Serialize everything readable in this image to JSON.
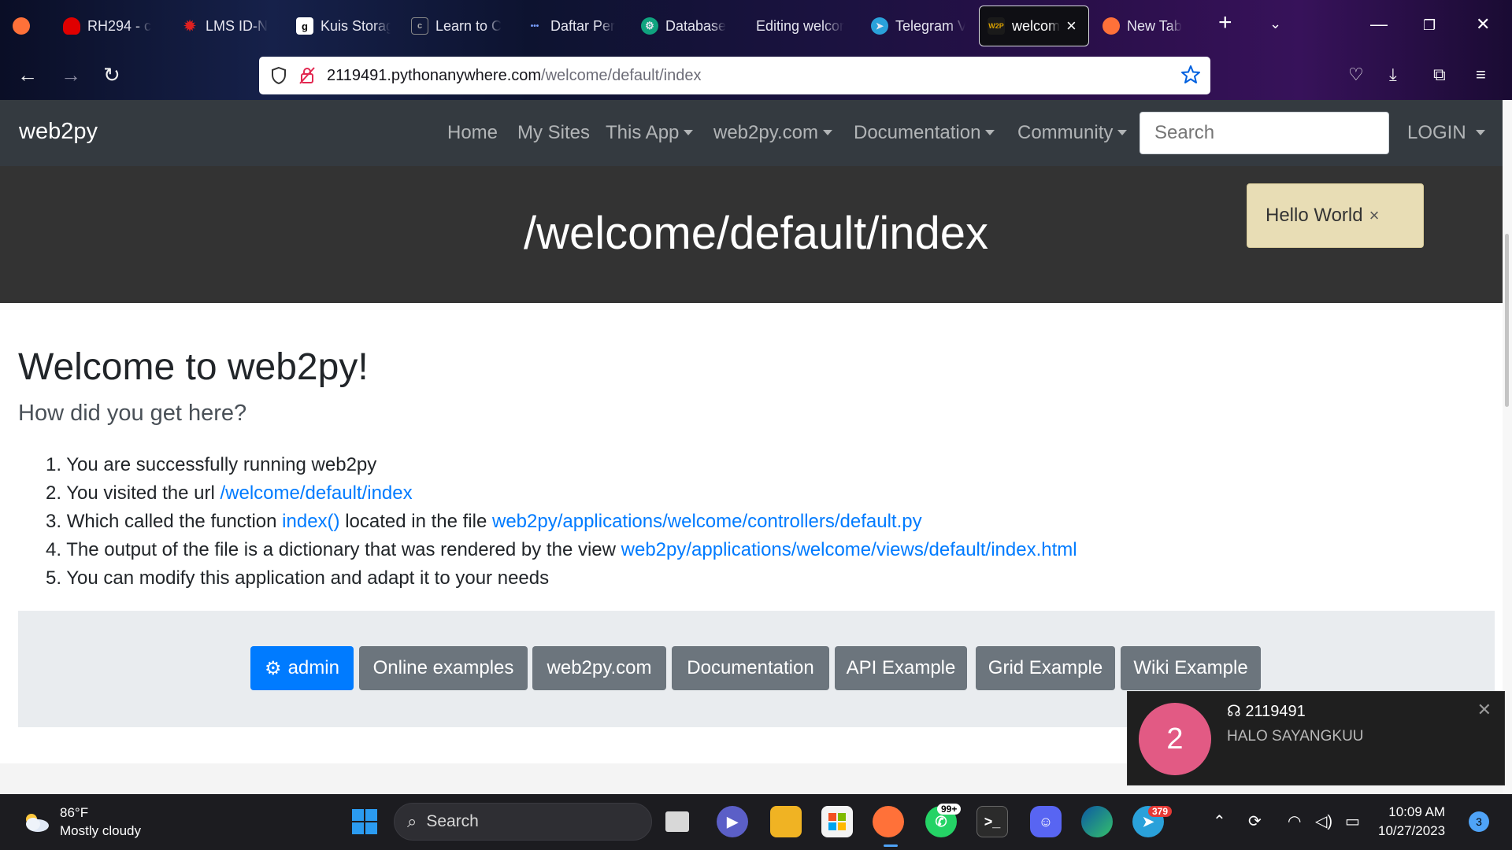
{
  "browser": {
    "tabs": [
      {
        "label": "RH294 - c",
        "icon": "redhat-icon",
        "color": "#e00000"
      },
      {
        "label": "LMS ID-N",
        "icon": "lms-icon",
        "color": "#e02020"
      },
      {
        "label": "Kuis Storag",
        "icon": "g-icon",
        "color": "#ffffff"
      },
      {
        "label": "Learn to C",
        "icon": "doc-icon",
        "color": "#888888"
      },
      {
        "label": "Daftar Per",
        "icon": "dots-icon",
        "color": "#3b6cff"
      },
      {
        "label": "Database",
        "icon": "chatgpt-icon",
        "color": "#10a37f"
      },
      {
        "label": "Editing welcor",
        "icon": "blank-icon",
        "color": "#444444"
      },
      {
        "label": "Telegram V",
        "icon": "telegram-icon",
        "color": "#2aa1da"
      },
      {
        "label": "welcom",
        "icon": "w2p-icon",
        "color": "#d9a000"
      },
      {
        "label": "New Tab",
        "icon": "firefox-icon",
        "color": "#ff7139"
      }
    ],
    "url_host": "2119491.pythonanywhere.com",
    "url_path": "/welcome/default/index"
  },
  "navbar": {
    "brand": "web2py",
    "items": [
      "Home",
      "My Sites",
      "This App",
      "web2py.com",
      "Documentation",
      "Community"
    ],
    "search_placeholder": "Search",
    "login": "LOGIN"
  },
  "hero": {
    "title": "/welcome/default/index",
    "flash": "Hello World",
    "flash_close": "×"
  },
  "content": {
    "heading": "Welcome to web2py!",
    "lead": "How did you get here?",
    "steps": {
      "s1": "You are successfully running web2py",
      "s2_text": "You visited the url ",
      "s2_link": "/welcome/default/index",
      "s3_text": "Which called the function ",
      "s3_link1": "index()",
      "s3_mid": " located in the file ",
      "s3_link2": "web2py/applications/welcome/controllers/default.py",
      "s4_text": "The output of the file is a dictionary that was rendered by the view ",
      "s4_link": "web2py/applications/welcome/views/default/index.html",
      "s5": "You can modify this application and adapt it to your needs"
    },
    "buttons": [
      "admin",
      "Online examples",
      "web2py.com",
      "Documentation",
      "API Example",
      "Grid Example",
      "Wiki Example"
    ]
  },
  "toast": {
    "avatar_text": "2",
    "name": "2119491",
    "message": "HALO SAYANGKUU"
  },
  "taskbar": {
    "temp": "86°F",
    "condition": "Mostly cloudy",
    "search": "Search",
    "whatsapp_badge": "99+",
    "telegram_badge": "379",
    "time": "10:09 AM",
    "date": "10/27/2023",
    "notifications": "3"
  },
  "colors": {
    "navbar_bg": "#343a40",
    "hero_bg": "#333333",
    "link": "#007bff",
    "primary_button": "#007bff",
    "secondary_button": "#6c757d",
    "flash_bg": "#e8ddb5"
  }
}
